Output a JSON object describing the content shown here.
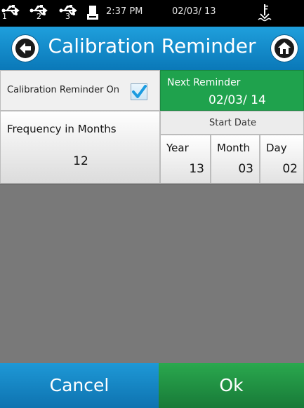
{
  "status_bar": {
    "usb_ports": [
      "1",
      "2",
      "3"
    ],
    "time": "2:37 PM",
    "date": "02/03/ 13"
  },
  "header": {
    "title": "Calibration Reminder",
    "back_icon": "back-arrow-icon",
    "home_icon": "home-icon"
  },
  "form": {
    "reminder_on_label": "Calibration Reminder On",
    "reminder_on_checked": true,
    "next_reminder_label": "Next Reminder",
    "next_reminder_date": "02/03/ 14",
    "frequency_label": "Frequency in Months",
    "frequency_value": "12",
    "start_date_label": "Start Date",
    "year_label": "Year",
    "year_value": "13",
    "month_label": "Month",
    "month_value": "03",
    "day_label": "Day",
    "day_value": "02"
  },
  "footer": {
    "cancel_label": "Cancel",
    "ok_label": "Ok"
  },
  "colors": {
    "title_blue": "#0a78b8",
    "accent_green": "#1fa24d",
    "checkbox_check": "#1a9be0"
  }
}
